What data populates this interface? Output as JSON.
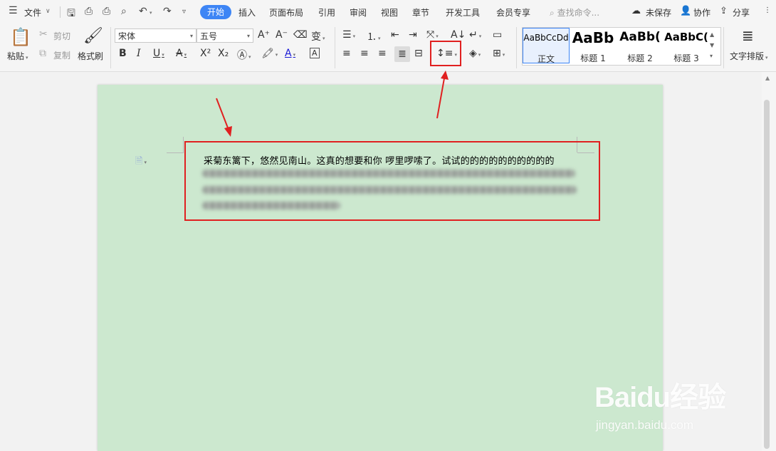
{
  "menubar": {
    "file_label": "文件",
    "tabs": [
      "开始",
      "插入",
      "页面布局",
      "引用",
      "审阅",
      "视图",
      "章节",
      "开发工具",
      "会员专享"
    ],
    "search_placeholder": "查找命令...",
    "unsaved_label": "未保存",
    "collaborate_label": "协作",
    "share_label": "分享"
  },
  "ribbon": {
    "paste_label": "粘贴",
    "cut_label": "剪切",
    "copy_label": "复制",
    "format_painter_label": "格式刷",
    "font_name": "宋体",
    "font_size": "五号",
    "styles": [
      {
        "preview": "AaBbCcDd",
        "label": "正文"
      },
      {
        "preview": "AaBb",
        "label": "标题 1"
      },
      {
        "preview": "AaBb(",
        "label": "标题 2"
      },
      {
        "preview": "AaBbC(",
        "label": "标题 3"
      }
    ],
    "text_layout_label": "文字排版"
  },
  "document": {
    "paragraph_line1": "采菊东篱下，悠然见南山。这真的想要和你 啰里啰嗦了。试试的的的的的的的的的的"
  },
  "watermark": {
    "brand": "Baidu经验",
    "url": "jingyan.baidu.com"
  },
  "colors": {
    "accent": "#3d85f5",
    "annotation_red": "#e02020",
    "page_bg": "#cce8cf"
  }
}
